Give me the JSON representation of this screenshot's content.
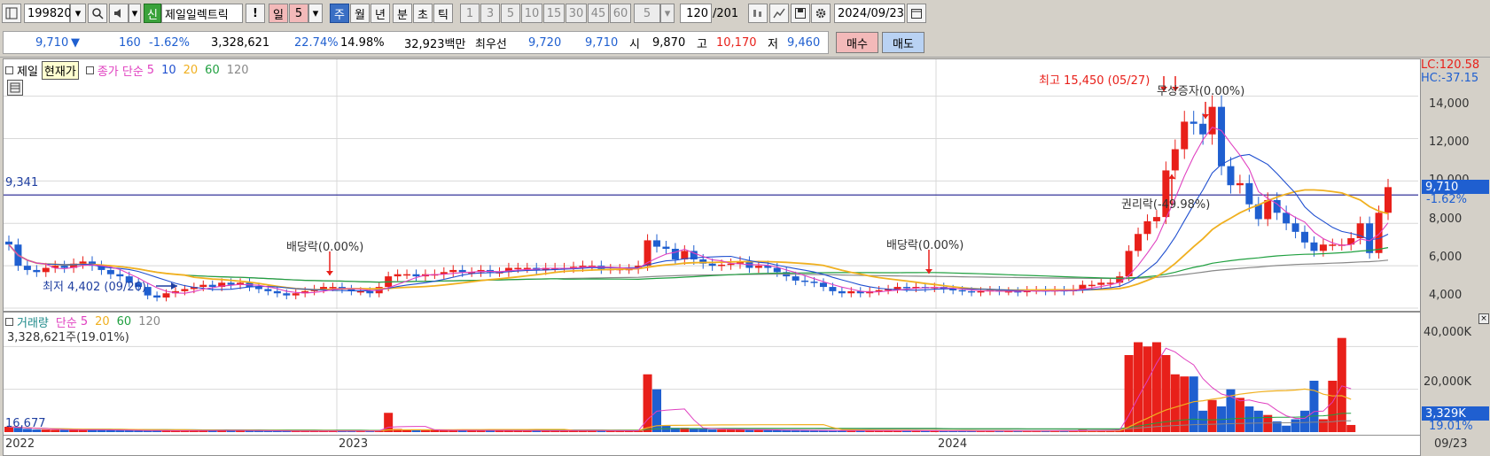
{
  "toolbar": {
    "code": "199820",
    "badge": "신",
    "name": "제일일렉트릭",
    "exclaim": "!",
    "periods": [
      "일",
      "5",
      "주",
      "월",
      "년",
      "분",
      "초",
      "틱"
    ],
    "minutes": [
      "1",
      "3",
      "5",
      "10",
      "15",
      "30",
      "45",
      "60"
    ],
    "sel_min": "5",
    "count": "120",
    "count_total": "/201",
    "date": "2024/09/23"
  },
  "quote": {
    "price": "9,710",
    "arrow": "▼",
    "change": "160",
    "change_pct": "-1.62%",
    "volume": "3,328,621",
    "vol_ratio": "22.74%",
    "turnover": "14.98%",
    "amount": "32,923백만",
    "bid_label": "최우선",
    "ask": "9,720",
    "bid": "9,710",
    "open_label": "시",
    "open": "9,870",
    "high_label": "고",
    "high": "10,170",
    "low_label": "저",
    "low": "9,460",
    "buy": "매수",
    "sell": "매도"
  },
  "legend": {
    "stock": "제일",
    "stock_tip": "현재가",
    "ma_label": "종가 단순",
    "ma_periods": [
      "5",
      "10",
      "20",
      "60",
      "120"
    ],
    "vol_label": "거래량",
    "vol_ma_label": "단순",
    "vol_periods": [
      "5",
      "20",
      "60",
      "120"
    ]
  },
  "colors": {
    "up": "#e8201a",
    "down": "#1f5fd0",
    "ma5": "#e040c0",
    "ma10": "#2050d0",
    "ma20": "#f0b020",
    "ma60": "#20a040",
    "ma120": "#888888"
  },
  "chart_data": [
    {
      "type": "candlestick",
      "title": "제일일렉트릭 주봉",
      "ylim": [
        4000,
        15700
      ],
      "y_ticks": [
        "14,000",
        "12,000",
        "10,000",
        "8,000",
        "6,000",
        "4,000"
      ],
      "x_labels": [
        "2022",
        "2023",
        "2024"
      ],
      "cursor_date": "09/23",
      "lc": "LC:120.58",
      "hc": "HC:-37.15",
      "hline_label": "9,341",
      "last_price": "9,710",
      "last_pct": "-1.62%",
      "annotations": {
        "high": "최고 15,450 (05/27)",
        "low": "최저 4,402 (09/26)",
        "div1": "배당락(0.00%)",
        "div2": "배당락(0.00%)",
        "bonus": "무상증자(0.00%)",
        "rights": "권리락(-49.98%)"
      },
      "close": [
        7000,
        6000,
        5800,
        5700,
        5900,
        6000,
        5900,
        6100,
        6200,
        6000,
        5800,
        5600,
        5500,
        5200,
        5000,
        4600,
        4500,
        4700,
        4800,
        4900,
        5000,
        5100,
        5000,
        5200,
        5100,
        5200,
        5000,
        4900,
        4800,
        4700,
        4600,
        4700,
        4800,
        4900,
        5000,
        5000,
        4900,
        4800,
        4800,
        4700,
        5000,
        5500,
        5600,
        5600,
        5500,
        5600,
        5600,
        5700,
        5800,
        5700,
        5700,
        5800,
        5700,
        5700,
        5900,
        5900,
        5900,
        5800,
        5900,
        5900,
        5900,
        5950,
        6000,
        6000,
        5850,
        5850,
        5850,
        5850,
        6000,
        7200,
        6900,
        6800,
        6300,
        6700,
        6300,
        6100,
        6000,
        6050,
        6100,
        6200,
        5900,
        6000,
        5900,
        5700,
        5500,
        5300,
        5250,
        5200,
        5000,
        4800,
        4700,
        4800,
        4700,
        4800,
        4850,
        4900,
        5000,
        4950,
        5000,
        4950,
        5000,
        4900,
        4850,
        4800,
        4750,
        4800,
        4850,
        4800,
        4800,
        4750,
        4850,
        4850,
        4800,
        4850,
        4800,
        4900,
        5100,
        5100,
        5200,
        5200,
        5500,
        6700,
        7500,
        8100,
        8300,
        10500,
        11500,
        12800,
        12700,
        12200,
        13500,
        10700,
        9800,
        9900,
        8900,
        8200,
        9100,
        8500,
        8000,
        7600,
        7100,
        6700,
        7000,
        7000,
        7000,
        7300,
        8000,
        6600,
        8500,
        9710
      ],
      "vol_k": [
        2500,
        2000,
        1500,
        1200,
        1200,
        1100,
        1000,
        1100,
        1000,
        1200,
        1000,
        900,
        800,
        800,
        700,
        600,
        800,
        700,
        600,
        700,
        800,
        900,
        800,
        700,
        700,
        800,
        700,
        600,
        500,
        500,
        500,
        600,
        500,
        500,
        600,
        500,
        600,
        500,
        500,
        600,
        800,
        9000,
        1500,
        1200,
        800,
        800,
        1000,
        800,
        800,
        800,
        800,
        800,
        800,
        800,
        700,
        700,
        600,
        700,
        700,
        700,
        700,
        700,
        700,
        700,
        700,
        600,
        600,
        600,
        700,
        27000,
        20000,
        3000,
        2000,
        2000,
        1500,
        1500,
        1200,
        1200,
        1200,
        1200,
        1000,
        1000,
        1000,
        900,
        900,
        800,
        800,
        700,
        700,
        700,
        700,
        600,
        600,
        700,
        700,
        700,
        600,
        700,
        600,
        600,
        600,
        500,
        600,
        500,
        500,
        600,
        600,
        500,
        500,
        600,
        500,
        600,
        500,
        600,
        600,
        600,
        1000,
        800,
        800,
        800,
        1200,
        36000,
        42000,
        40000,
        42000,
        36000,
        27000,
        26000,
        26000,
        10000,
        15000,
        12000,
        20000,
        16000,
        12000,
        10000,
        8000,
        5000,
        3000,
        6000,
        10000,
        24000,
        6000,
        24000,
        44000,
        3329
      ],
      "vol_ylim": [
        0,
        48000
      ],
      "vol_ticks": [
        "40,000K",
        "20,000K"
      ],
      "vol_value": "3,329K",
      "vol_pct": "19.01%",
      "vol_caption": "3,328,621주(19.01%)",
      "vol_min_label": "16,677"
    }
  ]
}
